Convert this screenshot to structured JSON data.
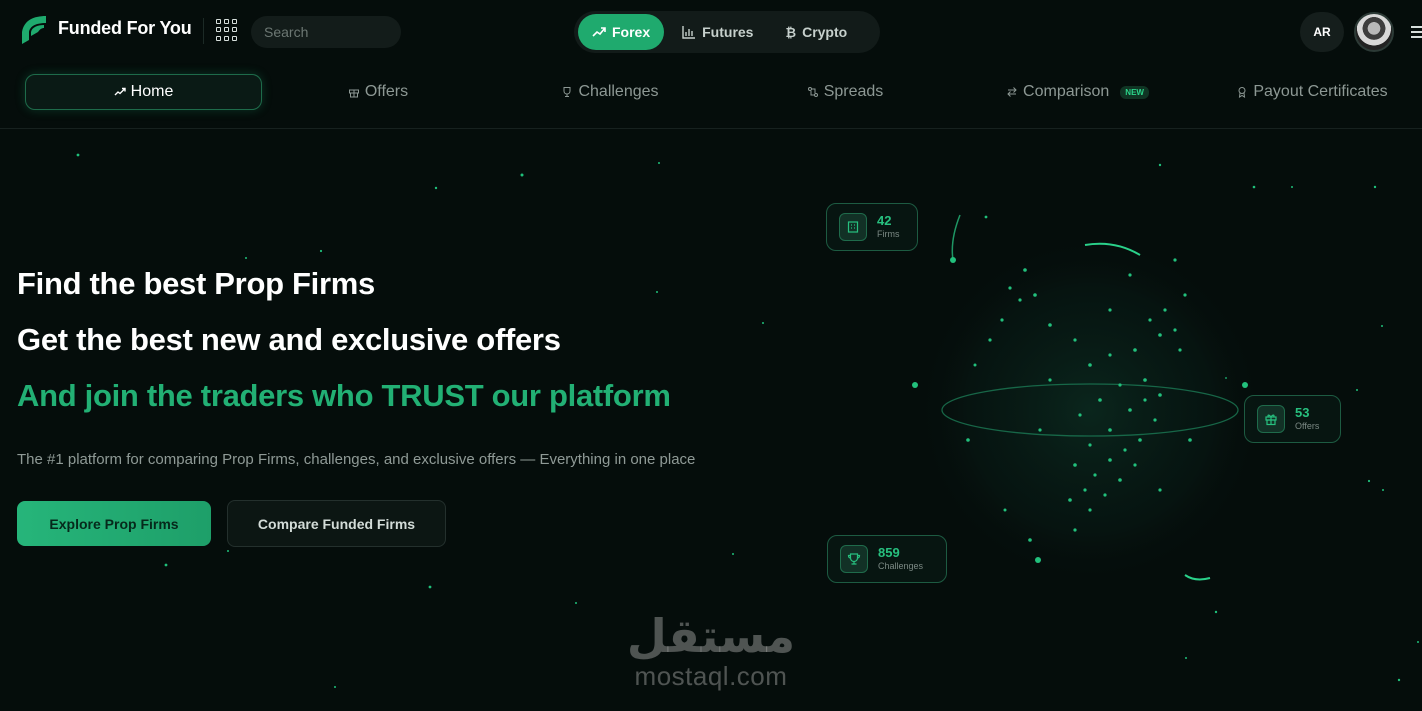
{
  "brand": {
    "name": "Funded For You"
  },
  "search": {
    "placeholder": "Search"
  },
  "markets": [
    {
      "label": "Forex",
      "icon": "trend-up-icon",
      "active": true
    },
    {
      "label": "Futures",
      "icon": "bar-chart-icon",
      "active": false
    },
    {
      "label": "Crypto",
      "icon": "bitcoin-icon",
      "active": false
    }
  ],
  "header": {
    "language": "AR"
  },
  "nav": [
    {
      "label": "Home",
      "icon": "trend-up-icon",
      "active": true
    },
    {
      "label": "Offers",
      "icon": "gift-icon"
    },
    {
      "label": "Challenges",
      "icon": "trophy-icon"
    },
    {
      "label": "Spreads",
      "icon": "swap-icon"
    },
    {
      "label": "Comparison",
      "icon": "compare-icon",
      "badge": "NEW"
    },
    {
      "label": "Payout Certificates",
      "icon": "award-icon"
    }
  ],
  "hero": {
    "line1": "Find the best Prop Firms",
    "line2": "Get the best new and exclusive offers",
    "line3": "And join the traders who TRUST our platform",
    "subtext": "The #1 platform for comparing Prop Firms, challenges, and exclusive offers — Everything in one place",
    "primary_cta": "Explore Prop Firms",
    "secondary_cta": "Compare Funded Firms"
  },
  "stats": [
    {
      "value": "42",
      "label": "Firms",
      "icon": "building-icon"
    },
    {
      "value": "53",
      "label": "Offers",
      "icon": "gift-icon"
    },
    {
      "value": "859",
      "label": "Challenges",
      "icon": "trophy-icon"
    }
  ],
  "watermark": {
    "arabic": "مستقل",
    "latin": "mostaql.com"
  },
  "colors": {
    "accent": "#1faa6e",
    "accent_text": "#22b074",
    "background": "#050d0b"
  }
}
